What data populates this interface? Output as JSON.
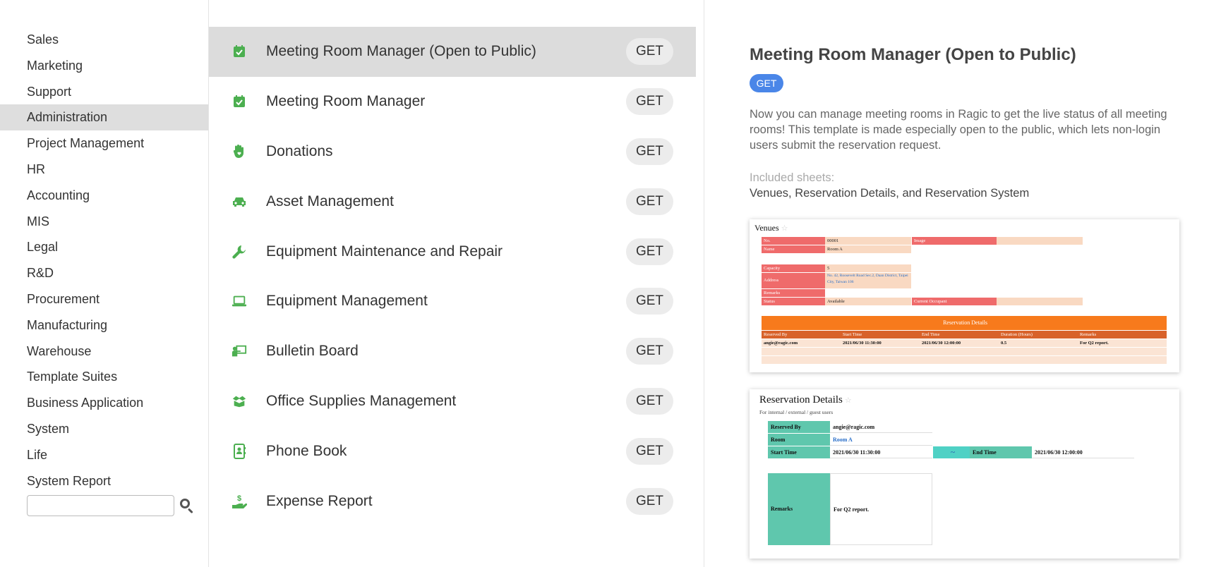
{
  "sidebar": {
    "categories": [
      "Sales",
      "Marketing",
      "Support",
      "Administration",
      "Project Management",
      "HR",
      "Accounting",
      "MIS",
      "Legal",
      "R&D",
      "Procurement",
      "Manufacturing",
      "Warehouse",
      "Template Suites",
      "Business Application",
      "System",
      "Life",
      "System Report"
    ],
    "active_category": "Administration",
    "search": {
      "value": "",
      "placeholder": ""
    }
  },
  "templates": {
    "get_label": "GET",
    "items": [
      {
        "name": "Meeting Room Manager (Open to Public)",
        "icon": "calendar-check-icon"
      },
      {
        "name": "Meeting Room Manager",
        "icon": "calendar-check-icon"
      },
      {
        "name": "Donations",
        "icon": "hand-heart-icon"
      },
      {
        "name": "Asset Management",
        "icon": "car-icon"
      },
      {
        "name": "Equipment Maintenance and Repair",
        "icon": "wrench-icon"
      },
      {
        "name": "Equipment Management",
        "icon": "laptop-icon"
      },
      {
        "name": "Bulletin Board",
        "icon": "presentation-icon"
      },
      {
        "name": "Office Supplies Management",
        "icon": "box-open-icon"
      },
      {
        "name": "Phone Book",
        "icon": "address-book-icon"
      },
      {
        "name": "Expense Report",
        "icon": "hand-dollar-icon"
      }
    ],
    "active_index": 0,
    "icon_color": "#4caf50"
  },
  "detail": {
    "title": "Meeting Room Manager (Open to Public)",
    "get_label": "GET",
    "description": "Now you can manage meeting rooms in Ragic to get the live status of all meeting rooms! This template is made especially open to the public, which lets non-login users submit the reservation request.",
    "included_label": "Included sheets:",
    "included_value": "Venues, Reservation Details, and Reservation System",
    "preview1": {
      "title": "Venues",
      "no_label": "No.",
      "no_value": "00001",
      "image_label": "Image",
      "name_label": "Name",
      "name_value": "Room A",
      "capacity_label": "Capacity",
      "capacity_value": "5",
      "address_label": "Address",
      "address_value": "No. 42, Roosevelt Road Sec.2, Daan District, Taipei City, Taiwan 106",
      "remarks_label": "Remarks",
      "status_label": "Status",
      "status_value": "Available",
      "current_occupant_label": "Current Occupant",
      "subtable_title": "Reservation Details",
      "subtable_headers": [
        "Reserved By",
        "Start Time",
        "End Time",
        "Duration (Hours)",
        "Remarks"
      ],
      "subtable_row": [
        "angie@ragic.com",
        "2021/06/30 11:30:00",
        "2021/06/30 12:00:00",
        "0.5",
        "For Q2 report."
      ]
    },
    "preview2": {
      "title": "Reservation Details",
      "subtitle": "For internal / external / guest users",
      "reserved_by_label": "Reserved By",
      "reserved_by_value": "angie@ragic.com",
      "room_label": "Room",
      "room_value": "Room A",
      "start_label": "Start Time",
      "start_value": "2021/06/30 11:30:00",
      "tilde": "~",
      "end_label": "End Time",
      "end_value": "2021/06/30 12:00:00",
      "remarks_label": "Remarks",
      "remarks_value": "For Q2 report."
    }
  },
  "colors": {
    "accent": "#4a86e8",
    "icon_green": "#4caf50",
    "active_bg": "#dcdcdc"
  }
}
